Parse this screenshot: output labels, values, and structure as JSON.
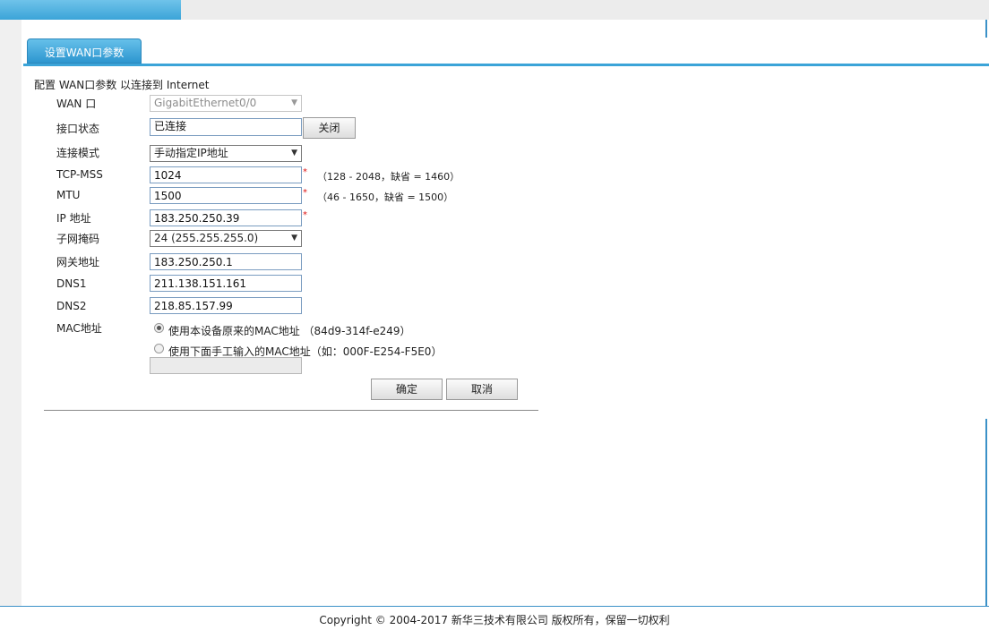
{
  "tab": {
    "label": "设置WAN口参数"
  },
  "description": "配置 WAN口参数 以连接到 Internet",
  "fields": {
    "wan_port": {
      "label": "WAN 口",
      "value": "GigabitEthernet0/0"
    },
    "status": {
      "label": "接口状态",
      "value": "已连接",
      "button": "关闭"
    },
    "mode": {
      "label": "连接模式",
      "value": "手动指定IP地址"
    },
    "tcp_mss": {
      "label": "TCP-MSS",
      "value": "1024",
      "required": "*",
      "hint": "（128 - 2048，缺省 = 1460）"
    },
    "mtu": {
      "label": "MTU",
      "value": "1500",
      "required": "*",
      "hint": "（46 - 1650，缺省 = 1500）"
    },
    "ip": {
      "label": "IP 地址",
      "value": "183.250.250.39",
      "required": "*"
    },
    "mask": {
      "label": "子网掩码",
      "value": "24 (255.255.255.0)"
    },
    "gateway": {
      "label": "网关地址",
      "value": "183.250.250.1"
    },
    "dns1": {
      "label": "DNS1",
      "value": "211.138.151.161"
    },
    "dns2": {
      "label": "DNS2",
      "value": "218.85.157.99"
    },
    "mac": {
      "label": "MAC地址",
      "option1": "使用本设备原来的MAC地址 （84d9-314f-e249）",
      "option2": "使用下面手工输入的MAC地址（如：000F-E254-F5E0）",
      "selected": "option1",
      "custom_value": ""
    }
  },
  "buttons": {
    "ok": "确定",
    "cancel": "取消"
  },
  "footer": "Copyright © 2004-2017 新华三技术有限公司 版权所有，保留一切权利",
  "icons": {
    "dropdown": "chevron-down-icon",
    "required": "asterisk-icon"
  },
  "colors": {
    "accent": "#3ba4d8",
    "required": "#dd1111"
  }
}
